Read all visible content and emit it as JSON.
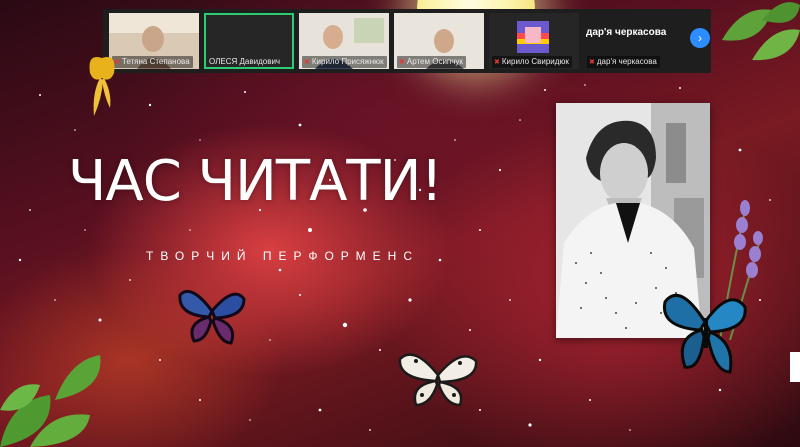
{
  "participants": [
    {
      "name": "Тетяна Степанова",
      "muted": true,
      "active": false
    },
    {
      "name": "ОЛЕСЯ Давидович",
      "muted": false,
      "active": true
    },
    {
      "name": "Кирило Присяжнюк",
      "muted": true,
      "active": false
    },
    {
      "name": "Артем Осипчук",
      "muted": true,
      "active": false
    },
    {
      "name": "Кирило Свиридюк",
      "muted": true,
      "active": false
    },
    {
      "name": "дар'я черкасова",
      "muted": true,
      "active": false
    }
  ],
  "large_name": "дар'я черкасова",
  "next_icon": "chevron-right-icon",
  "slide": {
    "title": "ЧАС ЧИТАТИ!",
    "subtitle": "ТВОРЧИЙ ПЕРФОРМЕНС"
  },
  "colors": {
    "active_speaker": "#2ecc71",
    "muted_mic": "#e53935",
    "zoom_blue": "#2d8cff",
    "strip_bg": "#1e1e1e"
  }
}
